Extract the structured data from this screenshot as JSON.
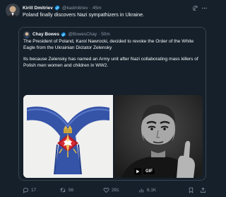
{
  "post": {
    "author_name": "Kirill Dmitriev",
    "author_handle": "@kadmitriev",
    "separator": "·",
    "time": "45m",
    "text": "Poland finally discovers Nazi sympathizers in Ukraine."
  },
  "quote": {
    "author_name": "Chay Bowes",
    "author_handle": "@BowesChay",
    "separator": "·",
    "time": "50m",
    "paragraph1": "The President of Poland, Karol Nawrocki, decided to revoke the Order of the White Eagle from the Ukrainian Dictator Zelensky",
    "paragraph2": "Its because Zelensky has named an Army unit after Nazi collaborating mass killers of Polish men women and children in WW2.",
    "gif_label": "GIF"
  },
  "actions": {
    "replies": "17",
    "reposts": "56",
    "likes": "291",
    "views": "6.1K"
  },
  "colors": {
    "background": "#15202b",
    "text": "#f7f9f9",
    "muted": "#8b98a5",
    "border": "#38444d",
    "verified": "#1d9bf0"
  },
  "icons": {
    "verified": "verified-badge-icon",
    "grok": "grok-icon",
    "more": "more-icon",
    "reply": "reply-icon",
    "repost": "repost-icon",
    "like": "like-icon",
    "views": "views-icon",
    "bookmark": "bookmark-icon",
    "share": "share-icon",
    "play": "play-icon"
  }
}
